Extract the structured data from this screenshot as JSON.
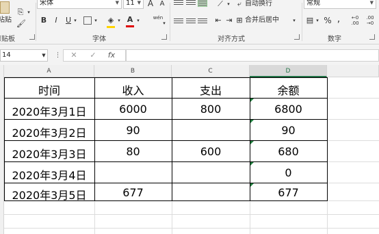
{
  "ribbon": {
    "clipboard": {
      "paste_label": "粘贴",
      "group_label": "剪贴板"
    },
    "font": {
      "name": "宋体",
      "size": "11",
      "grow": "A",
      "shrink": "A",
      "bold": "B",
      "italic": "I",
      "underline": "U",
      "font_color_glyph": "A",
      "wen": "wén",
      "group_label": "字体"
    },
    "alignment": {
      "wrap_text": "自动换行",
      "merge_center": "合并后居中",
      "group_label": "对齐方式"
    },
    "number": {
      "format": "常规",
      "percent": "%",
      "comma": ",",
      "inc_decimal": "+.0\n.00",
      "dec_decimal": ".00\n+.0",
      "group_label": "数字"
    }
  },
  "formula_bar": {
    "name_box": "14",
    "cancel": "✕",
    "enter": "✓",
    "fx": "fx",
    "formula": ""
  },
  "sheet": {
    "columns": [
      "A",
      "B",
      "C",
      "D"
    ],
    "header_row": [
      "时间",
      "收入",
      "支出",
      "余额"
    ],
    "rows": [
      [
        "2020年3月1日",
        "6000",
        "800",
        "6800"
      ],
      [
        "2020年3月2日",
        "90",
        "",
        "90"
      ],
      [
        "2020年3月3日",
        "80",
        "600",
        "680"
      ],
      [
        "2020年3月4日",
        "",
        "",
        "0"
      ],
      [
        "2020年3月5日",
        "677",
        "",
        "677"
      ]
    ]
  },
  "colors": {
    "selected_col": "#217346",
    "error_triangle": "#1e7f3c",
    "active_align": "#c4e0c4"
  }
}
